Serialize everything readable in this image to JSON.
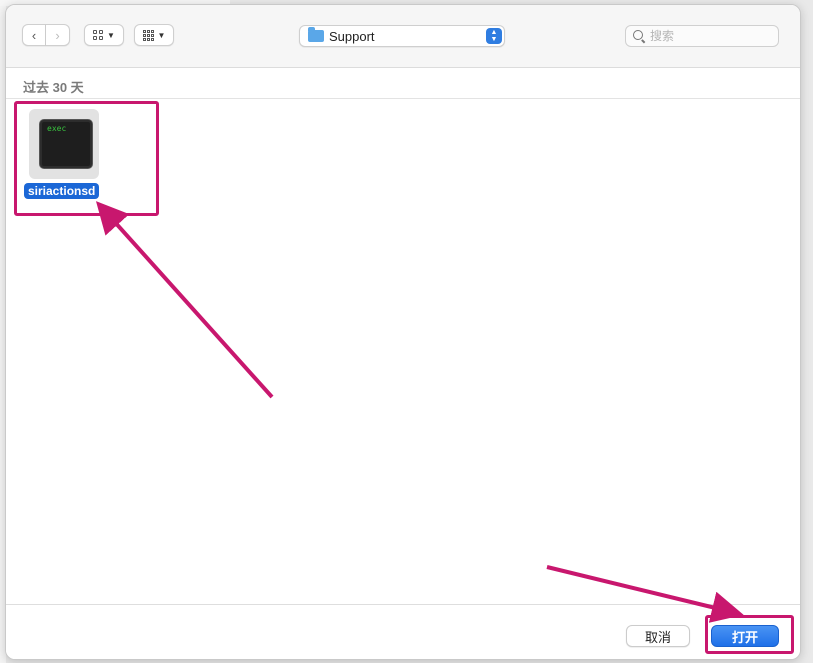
{
  "toolbar": {
    "back_symbol": "‹",
    "forward_symbol": "›",
    "location_label": "Support",
    "search_placeholder": "搜索"
  },
  "section": {
    "title": "过去 30 天"
  },
  "files": [
    {
      "name": "siriactionsd",
      "icon": "exec-icon",
      "icon_text": "exec",
      "selected": true
    }
  ],
  "footer": {
    "cancel_label": "取消",
    "open_label": "打开"
  },
  "colors": {
    "accent": "#1f70e8",
    "annotation": "#c8176e",
    "selection": "#1b67d6"
  }
}
